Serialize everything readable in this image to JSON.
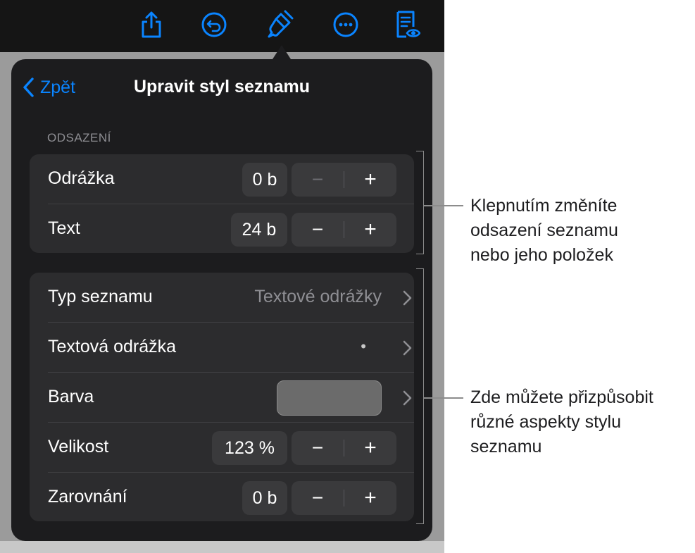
{
  "toolbar": {
    "icons": [
      "share-icon",
      "undo-icon",
      "format-brush-icon",
      "more-icon",
      "reader-view-icon"
    ],
    "accent_color": "#0a84ff"
  },
  "popover": {
    "back_label": "Zpět",
    "title": "Upravit styl seznamu",
    "indent_section": {
      "header": "ODSAZENÍ",
      "rows": [
        {
          "label": "Odrážka",
          "value": "0 b",
          "minus": "−",
          "plus": "+"
        },
        {
          "label": "Text",
          "value": "24 b",
          "minus": "−",
          "plus": "+"
        }
      ]
    },
    "style_section": {
      "list_type": {
        "label": "Typ seznamu",
        "value": "Textové odrážky"
      },
      "text_bullet": {
        "label": "Textová odrážka",
        "value": "•"
      },
      "color": {
        "label": "Barva",
        "swatch_color": "#6b6b6b"
      },
      "size": {
        "label": "Velikost",
        "value": "123 %",
        "minus": "−",
        "plus": "+"
      },
      "alignment": {
        "label": "Zarovnání",
        "value": "0 b",
        "minus": "−",
        "plus": "+"
      }
    }
  },
  "callouts": {
    "indent": [
      "Klepnutím změníte",
      "odsazení seznamu",
      "nebo jeho položek"
    ],
    "style": [
      "Zde můžete přizpůsobit",
      "různé aspekty stylu",
      "seznamu"
    ]
  }
}
